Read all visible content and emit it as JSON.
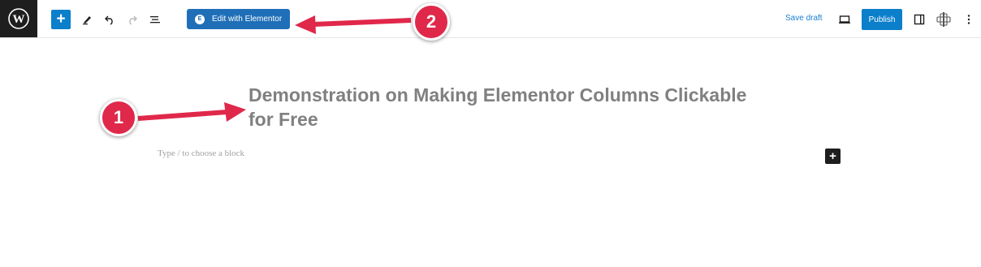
{
  "toolbar": {
    "wordpress_logo": "W",
    "add_block": "+",
    "edit_with_elementor": "Edit with Elementor",
    "elementor_badge": "E",
    "save_draft": "Save draft",
    "publish": "Publish"
  },
  "editor": {
    "title": "Demonstration on Making Elementor Columns Clickable for Free",
    "block_placeholder": "Type / to choose a block",
    "add_block_inline": "+"
  },
  "annotations": {
    "step_1": "1",
    "step_2": "2"
  },
  "colors": {
    "accent": "#0c7fcb",
    "elementor_button": "#1f6fb8",
    "annotation": "#e0284a",
    "wp_logo_bg": "#1e1e1e"
  },
  "icons": [
    "wordpress-logo-icon",
    "plus-icon",
    "pencil-icon",
    "undo-icon",
    "redo-icon",
    "list-view-icon",
    "desktop-preview-icon",
    "settings-sidebar-icon",
    "plugin-icon",
    "kebab-menu-icon"
  ]
}
